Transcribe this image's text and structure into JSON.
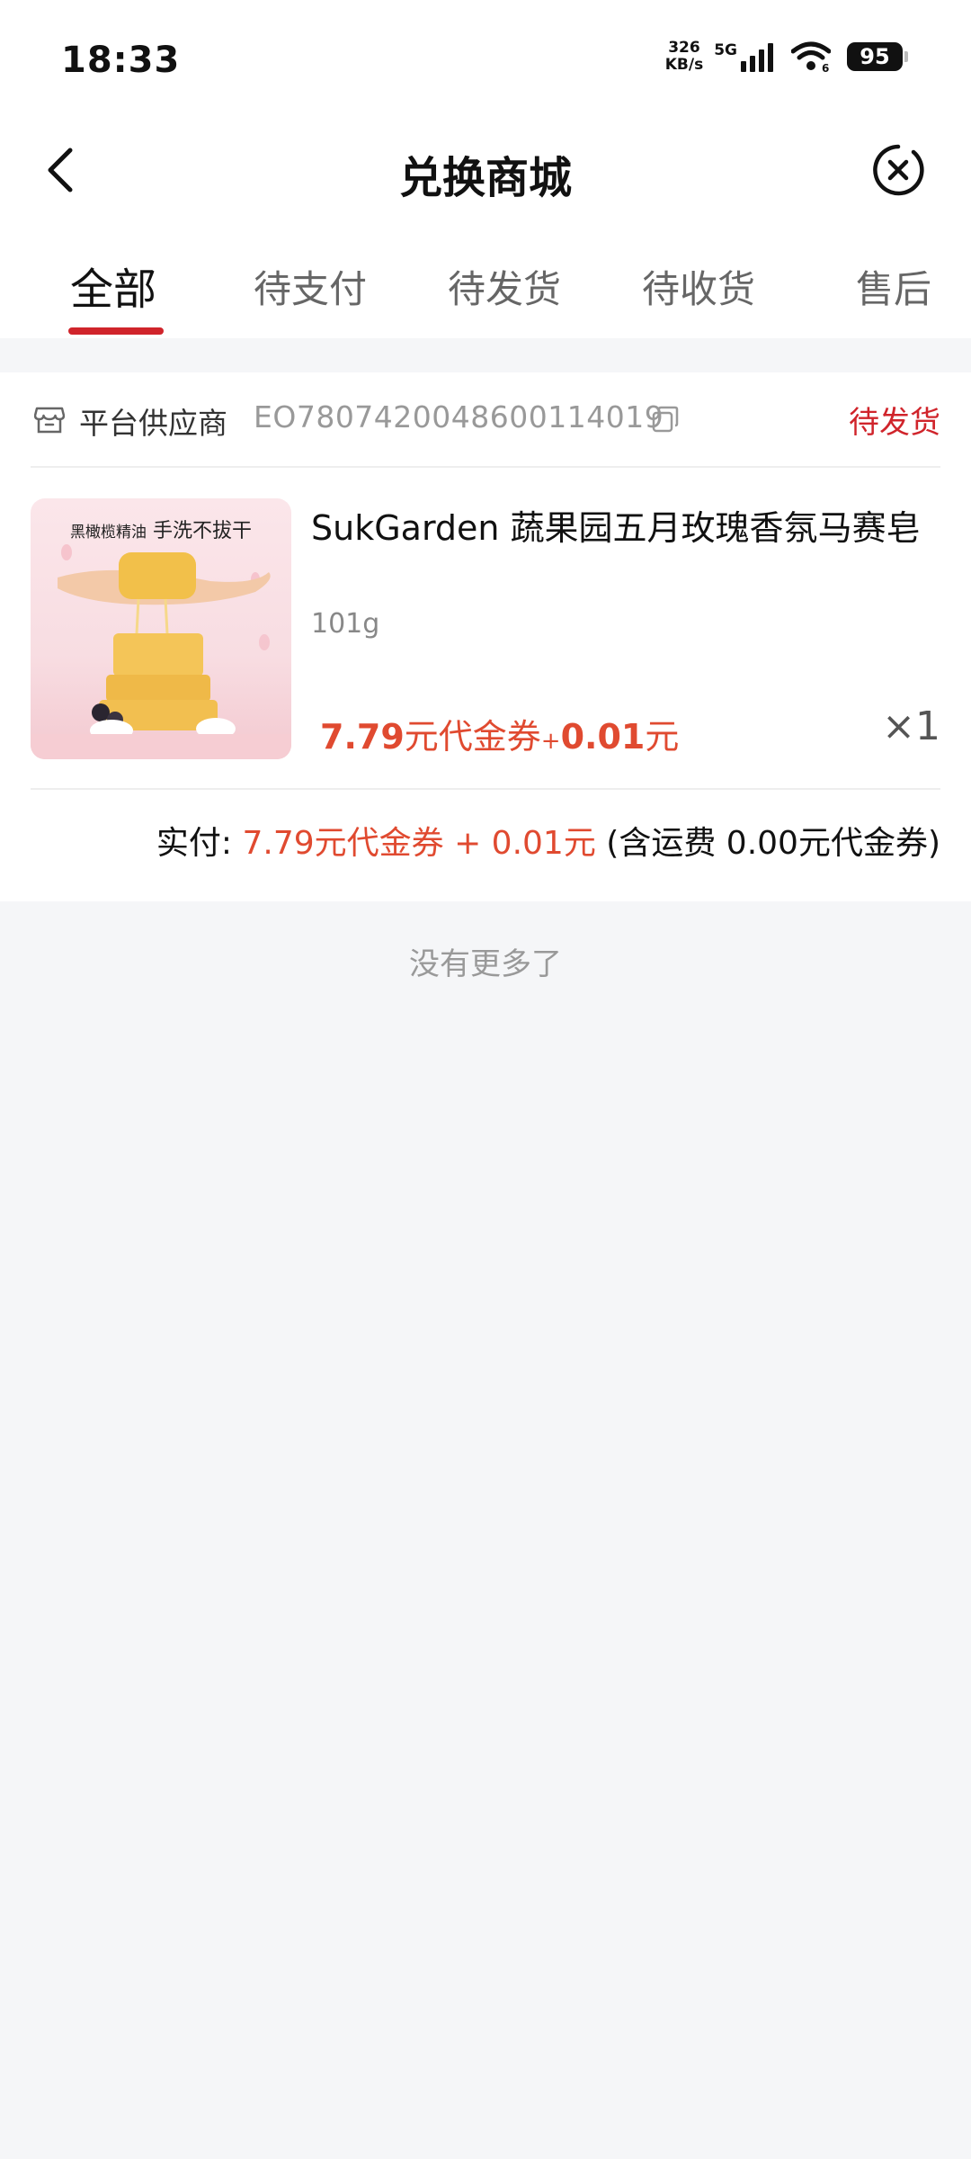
{
  "status_bar": {
    "time": "18:33",
    "net_speed_value": "326",
    "net_speed_unit": "KB/s",
    "network": "5G",
    "wifi_sub": "6",
    "battery": "95"
  },
  "header": {
    "title": "兑换商城",
    "back_icon": "chevron-left-icon",
    "close_icon": "close-circle-icon"
  },
  "tabs": [
    {
      "label": "全部",
      "active": true
    },
    {
      "label": "待支付",
      "active": false
    },
    {
      "label": "待发货",
      "active": false
    },
    {
      "label": "待收货",
      "active": false
    },
    {
      "label": "售后",
      "active": false
    }
  ],
  "order": {
    "store_name": "平台供应商",
    "order_no": "EO7807420048600114019",
    "status": "待发货",
    "product": {
      "image_caption_small": "黑橄榄精油",
      "image_caption_large": "手洗不拔干",
      "name": "SukGarden 蔬果园五月玫瑰香氛马赛皂",
      "spec": "101g",
      "price_voucher_value": "7.79",
      "price_voucher_unit": "元代金券",
      "price_plus": "+",
      "price_cash_value": "0.01",
      "price_cash_unit": "元",
      "quantity": "×1"
    },
    "paid": {
      "label": "实付:",
      "amount": "7.79元代金券 + 0.01元",
      "shipping_note": "(含运费 0.00元代金券)"
    }
  },
  "footer": {
    "no_more": "没有更多了"
  },
  "colors": {
    "accent_red": "#d0242b",
    "price_red": "#e04a30",
    "background": "#f5f6f8"
  }
}
